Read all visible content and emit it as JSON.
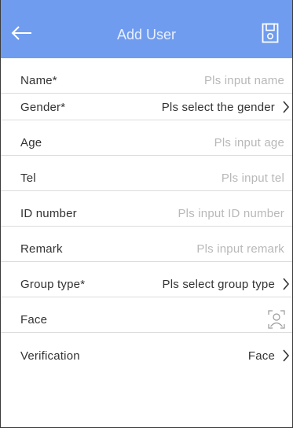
{
  "header": {
    "title": "Add User",
    "back_icon": "back-arrow-icon",
    "save_icon": "save-disk-icon",
    "background": "#6f9cef"
  },
  "form": {
    "name": {
      "label": "Name*",
      "placeholder": "Pls input name"
    },
    "gender": {
      "label": "Gender*",
      "value": "Pls select the gender"
    },
    "age": {
      "label": "Age",
      "placeholder": "Pls input age"
    },
    "tel": {
      "label": "Tel",
      "placeholder": "Pls input tel"
    },
    "id_number": {
      "label": "ID number",
      "placeholder": "Pls input ID number"
    },
    "remark": {
      "label": "Remark",
      "placeholder": "Pls input remark"
    },
    "group_type": {
      "label": "Group type*",
      "value": "Pls select group type"
    },
    "face": {
      "label": "Face",
      "icon": "face-capture-icon"
    },
    "verification": {
      "label": "Verification",
      "value": "Face"
    }
  }
}
